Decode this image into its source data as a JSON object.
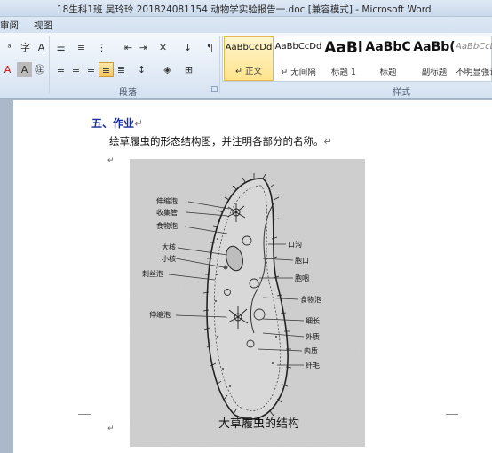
{
  "window": {
    "title": "18生科1班 吴玲玲 201824081154 动物学实验报告一.doc [兼容模式] - Microsoft Word"
  },
  "tabs": [
    "审阅",
    "视图"
  ],
  "ribbon": {
    "paragraph_group_label": "段落",
    "styles_group_label": "样式",
    "styles": [
      {
        "preview": "AaBbCcDd",
        "name": "↵ 正文",
        "selected": true
      },
      {
        "preview": "AaBbCcDd",
        "name": "↵ 无间隔",
        "selected": false
      },
      {
        "preview": "AaBl",
        "name": "标题 1",
        "selected": false
      },
      {
        "preview": "AaBbC",
        "name": "标题",
        "selected": false
      },
      {
        "preview": "AaBb(",
        "name": "副标题",
        "selected": false
      },
      {
        "preview": "AaBbCcDd",
        "name": "不明显强调",
        "selected": false
      }
    ]
  },
  "document": {
    "heading": "五、作业",
    "paragraph": "绘草履虫的形态结构图，并注明各部分的名称。",
    "paragraph_mark": "↵",
    "return_mark": "↵"
  },
  "figure": {
    "caption": "大草履虫的结构",
    "left_labels": [
      "伸缩泡",
      "收集管",
      "食物泡",
      "大核",
      "小核",
      "刺丝泡",
      "伸缩泡"
    ],
    "right_labels": [
      "口沟",
      "胞口",
      "胞咽",
      "食物泡",
      "细长",
      "外质",
      "内质",
      "纤毛"
    ]
  }
}
